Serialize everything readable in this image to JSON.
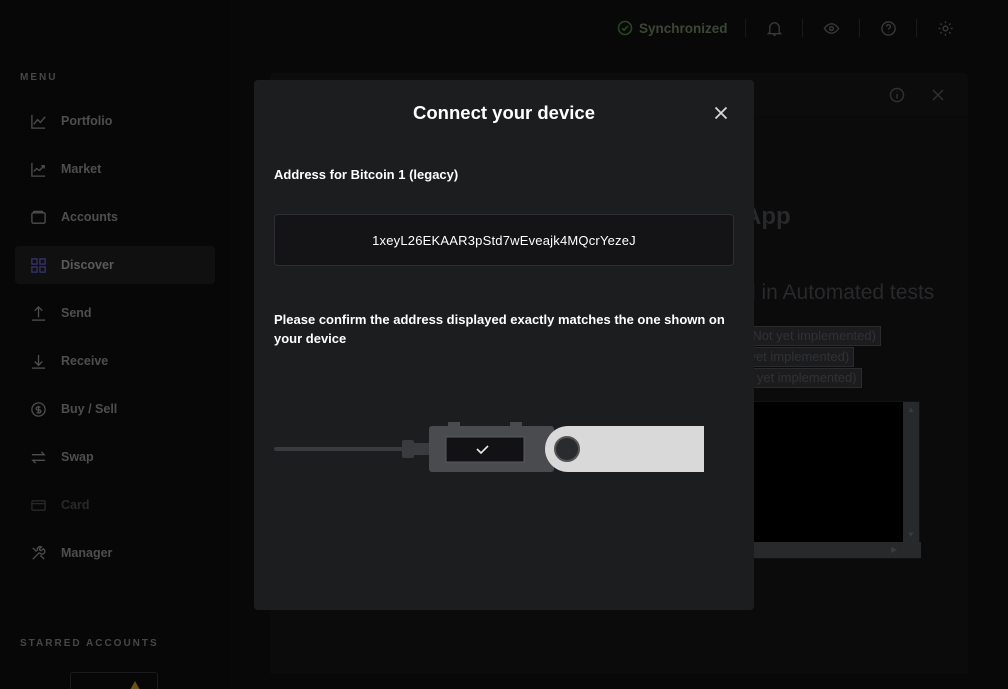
{
  "sidebar": {
    "menu_title": "MENU",
    "items": [
      {
        "label": "Portfolio",
        "icon": "chart-line-icon",
        "state": "normal"
      },
      {
        "label": "Market",
        "icon": "market-chart-icon",
        "state": "normal"
      },
      {
        "label": "Accounts",
        "icon": "wallet-icon",
        "state": "normal"
      },
      {
        "label": "Discover",
        "icon": "grid-icon",
        "state": "active"
      },
      {
        "label": "Send",
        "icon": "arrow-up-icon",
        "state": "normal"
      },
      {
        "label": "Receive",
        "icon": "arrow-down-icon",
        "state": "normal"
      },
      {
        "label": "Buy / Sell",
        "icon": "dollar-coin-icon",
        "state": "normal"
      },
      {
        "label": "Swap",
        "icon": "swap-arrows-icon",
        "state": "normal"
      },
      {
        "label": "Card",
        "icon": "card-icon",
        "state": "disabled"
      },
      {
        "label": "Manager",
        "icon": "tools-icon",
        "state": "normal"
      }
    ],
    "starred_title": "STARRED ACCOUNTS"
  },
  "topbar": {
    "sync_label": "Synchronized",
    "icons": [
      "bell-icon",
      "eye-icon",
      "help-icon",
      "gear-icon"
    ]
  },
  "background_app": {
    "title_fragment": "App",
    "subtitle_fragment": "d in Automated tests",
    "buttons": [
      "on (Not yet implemented)",
      "ot yet implemented)",
      "Not yet implemented)"
    ]
  },
  "modal": {
    "title": "Connect your device",
    "address_label": "Address for Bitcoin 1 (legacy)",
    "address": "1xeyL26EKAAR3pStd7wEveajk4MQcrYezeJ",
    "confirm_text": "Please confirm the address displayed exactly matches the one shown on your device"
  },
  "colors": {
    "accent": "#6f71d6",
    "sync_green": "#66be54",
    "modal_bg": "#1c1d1f"
  }
}
